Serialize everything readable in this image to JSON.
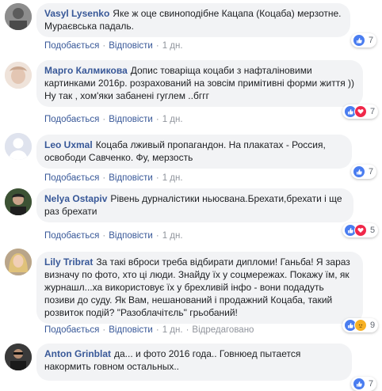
{
  "comments": [
    {
      "author": "Vasyl Lysenko",
      "text": "Яке ж оце свиноподібне Кацапа (Коцаба) мерзотне. Мураєвська падаль.",
      "like_label": "Подобається",
      "reply_label": "Відповісти",
      "time": "1 дн.",
      "reactions": [
        "like"
      ],
      "reaction_count": "7"
    },
    {
      "author": "Марго Калмикова",
      "text": "Допис товаріща коцаби з нафталіновими картинками 2016р. розрахований на зовсім примітивні форми життя )) Ну так , хом'яки забанені гуглем ..бггг",
      "like_label": "Подобається",
      "reply_label": "Відповісти",
      "time": "1 дн.",
      "reactions": [
        "like",
        "love"
      ],
      "reaction_count": "7"
    },
    {
      "author": "Leo Uxmal",
      "text": "Коцаба лживый пропагандон. На плакатах - Россия, освободи Савченко. Фу, мерзость",
      "like_label": "Подобається",
      "reply_label": "Відповісти",
      "time": "1 дн.",
      "reactions": [
        "like"
      ],
      "reaction_count": "7"
    },
    {
      "author": "Nelya Ostapiv",
      "text": "Рівень дурналістики ньюсвана.Брехати,брехати і ще раз брехати",
      "like_label": "Подобається",
      "reply_label": "Відповісти",
      "time": "1 дн.",
      "reactions": [
        "like",
        "love"
      ],
      "reaction_count": "5"
    },
    {
      "author": "Lily Tribrat",
      "text": "За такі вброси треба відбирати дипломи! Ганьба! Я зараз визначу по фото, хто ці люди. Знайду їх у соцмережах. Покажу їм, як журнашл...ха використовує їх у брехливій інфо - вони подадуть позиви до суду. Як Вам, нешанований і продажний Коцаба, такий розвиток подій? \"Разоблачітєль\" грьобаний!",
      "like_label": "Подобається",
      "reply_label": "Відповісти",
      "time": "1 дн.",
      "edited_label": "Відредаговано",
      "reactions": [
        "like",
        "angry"
      ],
      "reaction_count": "9"
    },
    {
      "author": "Anton Grinblat",
      "text": "да... и фото 2016 года.. Говнюед пытается накормить говном остальных..",
      "reactions": [
        "like"
      ],
      "reaction_count": "7"
    }
  ],
  "colors": {
    "author": "#385898",
    "bubble": "#f2f3f5",
    "meta": "#90949c",
    "like": "#4a7df0",
    "love": "#f0284a",
    "angry": "#f7b125"
  },
  "icons": {
    "like": "thumbs-up-icon",
    "love": "heart-icon",
    "angry": "angry-face-icon"
  }
}
